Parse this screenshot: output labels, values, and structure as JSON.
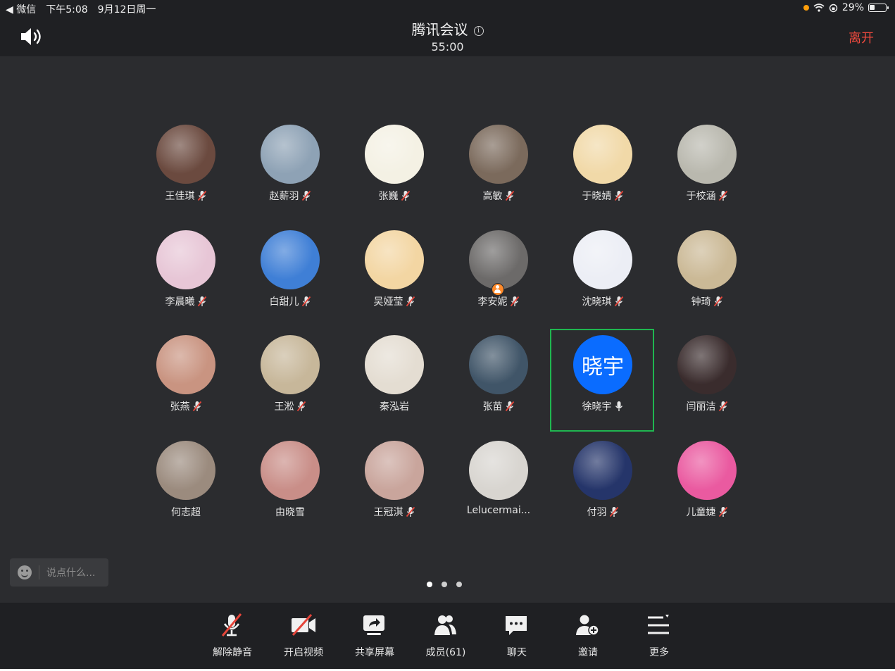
{
  "status_bar": {
    "back_app": "◀ 微信",
    "time": "下午5:08",
    "date": "9月12日周一",
    "battery": "29%"
  },
  "header": {
    "title": "腾讯会议",
    "timer": "55:00",
    "leave": "离开"
  },
  "participants": [
    {
      "name": "王佳琪",
      "mic": "muted",
      "avatar_bg": "#6b4a3f"
    },
    {
      "name": "赵薪羽",
      "mic": "muted",
      "avatar_bg": "#8ea2b5"
    },
    {
      "name": "张巍",
      "mic": "muted",
      "avatar_bg": "#f4f1e4"
    },
    {
      "name": "高敏",
      "mic": "muted",
      "avatar_bg": "#7b6a5c"
    },
    {
      "name": "于晓婧",
      "mic": "muted",
      "avatar_bg": "#f1d9a8"
    },
    {
      "name": "于校涵",
      "mic": "muted",
      "avatar_bg": "#b9b8ae"
    },
    {
      "name": "李晨曦",
      "mic": "muted",
      "avatar_bg": "#e7c6d6"
    },
    {
      "name": "白甜儿",
      "mic": "muted",
      "avatar_bg": "#3f7fd6"
    },
    {
      "name": "吴娅莹",
      "mic": "muted",
      "avatar_bg": "#f3d6a3"
    },
    {
      "name": "李安妮",
      "mic": "muted",
      "avatar_bg": "#6c6a69",
      "host": true
    },
    {
      "name": "沈晓琪",
      "mic": "muted",
      "avatar_bg": "#eceef5"
    },
    {
      "name": "钟琦",
      "mic": "muted",
      "avatar_bg": "#cbb996"
    },
    {
      "name": "张燕",
      "mic": "muted",
      "avatar_bg": "#c99481"
    },
    {
      "name": "王淞",
      "mic": "muted",
      "avatar_bg": "#c7b79a"
    },
    {
      "name": "秦泓岩",
      "mic": "none",
      "avatar_bg": "#e4ddd2"
    },
    {
      "name": "张苗",
      "mic": "muted",
      "avatar_bg": "#405568"
    },
    {
      "name": "徐晓宇",
      "mic": "on",
      "avatar_bg": "#0a6cff",
      "initials": "晓宇",
      "active": true
    },
    {
      "name": "闫丽洁",
      "mic": "muted",
      "avatar_bg": "#3a2c2d"
    },
    {
      "name": "何志超",
      "mic": "none",
      "avatar_bg": "#9b8b7e"
    },
    {
      "name": "由晓雪",
      "mic": "none",
      "avatar_bg": "#c98e88"
    },
    {
      "name": "王冠淇",
      "mic": "muted",
      "avatar_bg": "#c9a59c"
    },
    {
      "name": "Lelucermai...",
      "mic": "none",
      "avatar_bg": "#d8d5d0"
    },
    {
      "name": "付羽",
      "mic": "muted",
      "avatar_bg": "#25356a"
    },
    {
      "name": "儿童婕",
      "mic": "muted",
      "avatar_bg": "#ea5aa0"
    }
  ],
  "chat": {
    "placeholder": "说点什么..."
  },
  "pager": {
    "pages": 3,
    "current": 0
  },
  "toolbar": [
    {
      "id": "unmute",
      "label": "解除静音",
      "icon": "mic-muted-icon"
    },
    {
      "id": "video",
      "label": "开启视频",
      "icon": "camera-off-icon"
    },
    {
      "id": "share",
      "label": "共享屏幕",
      "icon": "share-screen-icon"
    },
    {
      "id": "members",
      "label": "成员(61)",
      "icon": "members-icon"
    },
    {
      "id": "chat",
      "label": "聊天",
      "icon": "chat-icon"
    },
    {
      "id": "invite",
      "label": "邀请",
      "icon": "invite-icon"
    },
    {
      "id": "more",
      "label": "更多",
      "icon": "more-icon"
    }
  ],
  "colors": {
    "background": "#2b2c2f",
    "bar": "#1f2023",
    "accent": "#0a6cff",
    "active_border": "#1fb650",
    "leave": "#f04a3e",
    "muted_red": "#e5453a"
  }
}
